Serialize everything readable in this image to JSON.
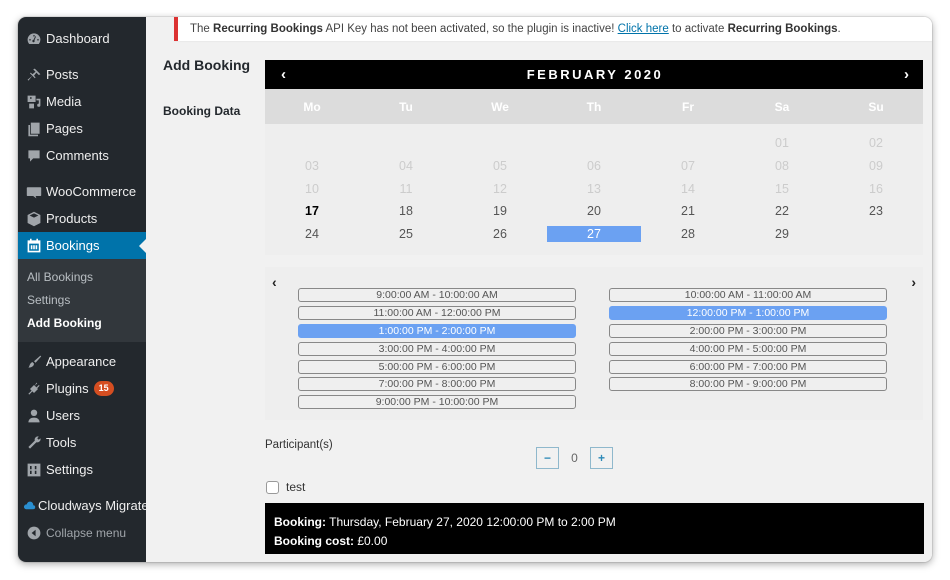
{
  "sidebar": {
    "items": [
      {
        "label": "Dashboard",
        "icon": "dashboard-icon"
      },
      {
        "label": "Posts",
        "icon": "pin-icon"
      },
      {
        "label": "Media",
        "icon": "media-icon"
      },
      {
        "label": "Pages",
        "icon": "pages-icon"
      },
      {
        "label": "Comments",
        "icon": "comment-icon"
      },
      {
        "label": "WooCommerce",
        "icon": "woocommerce-icon"
      },
      {
        "label": "Products",
        "icon": "box-icon"
      },
      {
        "label": "Bookings",
        "icon": "calendar-icon"
      },
      {
        "label": "Appearance",
        "icon": "paintbrush-icon"
      },
      {
        "label": "Plugins",
        "icon": "plugin-icon",
        "badge": "15"
      },
      {
        "label": "Users",
        "icon": "user-icon"
      },
      {
        "label": "Tools",
        "icon": "wrench-icon"
      },
      {
        "label": "Settings",
        "icon": "settings-icon"
      },
      {
        "label": "Cloudways Migrate",
        "icon": "cloud-icon"
      }
    ],
    "submenu": [
      {
        "label": "All Bookings"
      },
      {
        "label": "Settings"
      },
      {
        "label": "Add Booking"
      }
    ],
    "collapse_label": "Collapse menu"
  },
  "notice": {
    "prefix": "The ",
    "plugin1": "Recurring Bookings",
    "middle": " API Key has not been activated, so the plugin is inactive! ",
    "link": "Click here",
    "suffix": " to activate ",
    "plugin2": "Recurring Bookings",
    "end": "."
  },
  "page": {
    "title": "Add Booking",
    "field_label": "Booking Data"
  },
  "calendar": {
    "prev": "‹",
    "next": "›",
    "title": "FEBRUARY 2020",
    "weekdays": [
      "Mo",
      "Tu",
      "We",
      "Th",
      "Fr",
      "Sa",
      "Su"
    ],
    "weeks": [
      [
        null,
        null,
        null,
        null,
        null,
        "01",
        "02"
      ],
      [
        "03",
        "04",
        "05",
        "06",
        "07",
        "08",
        "09"
      ],
      [
        "10",
        "11",
        "12",
        "13",
        "14",
        "15",
        "16"
      ],
      [
        "17",
        "18",
        "19",
        "20",
        "21",
        "22",
        "23"
      ],
      [
        "24",
        "25",
        "26",
        "27",
        "28",
        "29",
        null
      ]
    ],
    "first_available": 17,
    "today": "17",
    "selected": "27"
  },
  "slots": {
    "prev": "‹",
    "next": "›",
    "left": [
      {
        "label": "9:00:00 AM - 10:00:00 AM",
        "selected": false
      },
      {
        "label": "11:00:00 AM - 12:00:00 PM",
        "selected": false
      },
      {
        "label": "1:00:00 PM - 2:00:00 PM",
        "selected": true
      },
      {
        "label": "3:00:00 PM - 4:00:00 PM",
        "selected": false
      },
      {
        "label": "5:00:00 PM - 6:00:00 PM",
        "selected": false
      },
      {
        "label": "7:00:00 PM - 8:00:00 PM",
        "selected": false
      },
      {
        "label": "9:00:00 PM - 10:00:00 PM",
        "selected": false
      }
    ],
    "right": [
      {
        "label": "10:00:00 AM - 11:00:00 AM",
        "selected": false
      },
      {
        "label": "12:00:00 PM - 1:00:00 PM",
        "selected": true
      },
      {
        "label": "2:00:00 PM - 3:00:00 PM",
        "selected": false
      },
      {
        "label": "4:00:00 PM - 5:00:00 PM",
        "selected": false
      },
      {
        "label": "6:00:00 PM - 7:00:00 PM",
        "selected": false
      },
      {
        "label": "8:00:00 PM - 9:00:00 PM",
        "selected": false
      }
    ]
  },
  "participants": {
    "label": "Participant(s)",
    "minus": "−",
    "value": "0",
    "plus": "+"
  },
  "checkbox": {
    "label": "test",
    "checked": false
  },
  "summary": {
    "booking_label": "Booking:",
    "booking_value": " Thursday, February 27, 2020 12:00:00 PM to 2:00 PM",
    "cost_label": "Booking cost:",
    "cost_value": " £0.00"
  },
  "colors": {
    "sidebar_bg": "#23282d",
    "active_menu": "#0073aa",
    "selected": "#6ba1f2",
    "notice_border": "#dc3232",
    "badge": "#d54e21"
  }
}
